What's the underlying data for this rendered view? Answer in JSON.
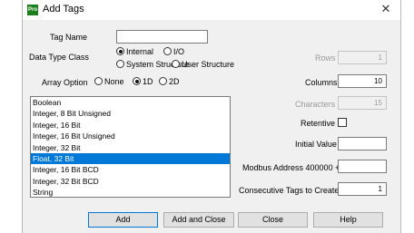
{
  "window": {
    "title": "Add Tags",
    "app_icon_text": "Pro",
    "close_glyph": "✕"
  },
  "form": {
    "tag_name_label": "Tag Name",
    "tag_name_value": "",
    "data_type_class_label": "Data Type Class",
    "data_type_class_options": [
      "Internal",
      "I/O",
      "System Structure",
      "User Structure"
    ],
    "data_type_class_selected": "Internal",
    "array_option_label": "Array Option",
    "array_options": [
      "None",
      "1D",
      "2D"
    ],
    "array_option_selected": "1D"
  },
  "data_types": {
    "items": [
      "Boolean",
      "Integer, 8 Bit Unsigned",
      "Integer, 16 Bit",
      "Integer, 16 Bit Unsigned",
      "Integer, 32 Bit",
      "Float, 32 Bit",
      "Integer, 16 Bit BCD",
      "Integer, 32 Bit BCD",
      "String"
    ],
    "selected": "Float, 32 Bit"
  },
  "right_panel": {
    "rows_label": "Rows",
    "rows_value": "1",
    "columns_label": "Columns",
    "columns_value": "10",
    "characters_label": "Characters",
    "characters_value": "15",
    "retentive_label": "Retentive",
    "retentive_checked": false,
    "initial_value_label": "Initial Value",
    "initial_value": "",
    "modbus_label": "Modbus Address 400000 +",
    "modbus_value": "",
    "consecutive_label": "Consecutive Tags to Create",
    "consecutive_value": "1"
  },
  "buttons": {
    "add": "Add",
    "add_and_close": "Add and Close",
    "close": "Close",
    "help": "Help"
  },
  "colors": {
    "selection": "#0078d7",
    "dialog_bg": "#f0f0f0",
    "app_icon": "#1b7f1b"
  }
}
